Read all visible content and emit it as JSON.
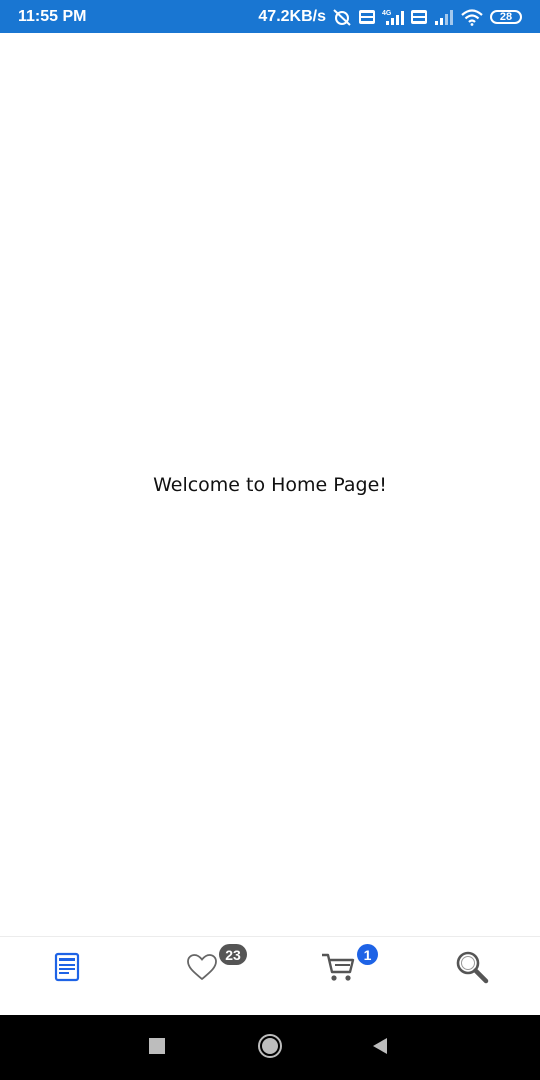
{
  "status_bar": {
    "time": "11:55 PM",
    "net_speed": "47.2KB/s",
    "battery": "28",
    "icons": [
      "alarm-off-icon",
      "volte-icon",
      "signal-4g-icon",
      "volte-icon",
      "signal-icon",
      "wifi-icon",
      "battery-icon"
    ]
  },
  "main": {
    "welcome_text": "Welcome to Home Page!"
  },
  "bottom_nav": {
    "items": [
      {
        "name": "home",
        "icon": "document-icon",
        "active": true
      },
      {
        "name": "favorites",
        "icon": "heart-icon",
        "badge": "23"
      },
      {
        "name": "cart",
        "icon": "cart-icon",
        "badge": "1"
      },
      {
        "name": "search",
        "icon": "search-icon"
      }
    ]
  },
  "colors": {
    "status_bar": "#1976d2",
    "accent": "#1e63e6",
    "badge_gray": "#555555",
    "icon_gray": "#666666"
  }
}
